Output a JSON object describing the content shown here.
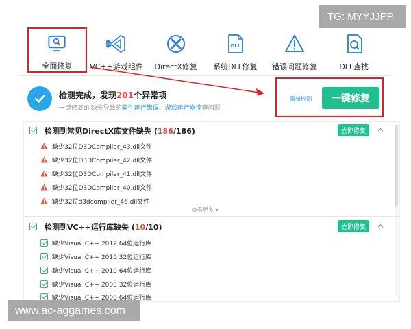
{
  "watermarks": {
    "top": "TG: MYYJJPP",
    "bottom": "www.ac-aggames.com"
  },
  "nav": {
    "tabs": [
      {
        "label": "全面修复",
        "icon": "monitor-search-icon"
      },
      {
        "label": "VC++游戏组件",
        "icon": "visual-studio-icon"
      },
      {
        "label": "DirectX修复",
        "icon": "directx-icon"
      },
      {
        "label": "系统DLL修复",
        "icon": "dll-file-icon"
      },
      {
        "label": "错误问题修复",
        "icon": "warning-triangle-icon"
      },
      {
        "label": "DLL查找",
        "icon": "dll-search-icon"
      }
    ]
  },
  "summary": {
    "title_prefix": "检测完成，发现",
    "count": "201",
    "title_suffix": "个异常项",
    "sub_prefix": "一键修复dll缺失导致的",
    "sub_link1": "软件运行错误",
    "sub_sep": "、",
    "sub_link2": "游戏运行崩溃",
    "sub_suffix": "等问题",
    "rescan_label": "重新检测",
    "fix_label": "一键修复"
  },
  "sections": {
    "directx": {
      "title": "检测到常见DirectX库文件缺失 (",
      "found": "186",
      "total": "/186)",
      "fix_label": "立即修复",
      "items": [
        "缺少32位D3DCompiler_43.dll文件",
        "缺少32位D3DCompiler_42.dll文件",
        "缺少32位D3DCompiler_41.dll文件",
        "缺少32位D3DCompiler_40.dll文件",
        "缺少32位d3dcompiler_46.dll文件"
      ],
      "more_label": "查看更多 ▾"
    },
    "vc": {
      "title": "检测到VC++运行库缺失 (",
      "found": "10",
      "total": "/10)",
      "fix_label": "立即修复",
      "items": [
        "缺少Visual C++ 2012 64位运行库",
        "缺少Visual C++ 2010 32位运行库",
        "缺少Visual C++ 2010 64位运行库",
        "缺少Visual C++ 2008 32位运行库",
        "缺少Visual C++ 2008 64位运行库"
      ]
    }
  },
  "colors": {
    "accent_green": "#1fbf8f",
    "link_blue": "#2a9df4",
    "alert_red": "#e8463a",
    "highlight_red": "#e02020",
    "check_green": "#2fb673"
  }
}
